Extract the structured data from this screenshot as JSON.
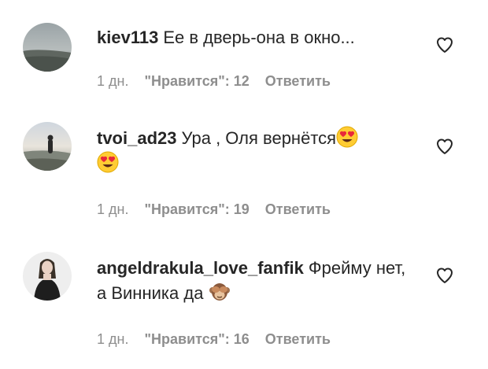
{
  "comments": [
    {
      "username": "kiev113",
      "text": "Ее в дверь-она в окно...",
      "time": "1 дн.",
      "likes": "\"Нравится\": 12",
      "reply": "Ответить",
      "avatar_icon": "avatar-photo-sea",
      "emojis": []
    },
    {
      "username": "tvoi_ad23",
      "text": "Ура , Оля вернётся",
      "time": "1 дн.",
      "likes": "\"Нравится\": 19",
      "reply": "Ответить",
      "avatar_icon": "avatar-photo-beach",
      "emojis": [
        "heart-eyes-emoji",
        "heart-eyes-emoji"
      ]
    },
    {
      "username": "angeldrakula_love_fanfik",
      "text": "Фрейму нет, а Винника да",
      "time": "1 дн.",
      "likes": "\"Нравится\": 16",
      "reply": "Ответить",
      "avatar_icon": "avatar-photo-girl",
      "emojis": [
        "see-no-evil-monkey-emoji"
      ]
    }
  ],
  "colors": {
    "text": "#262626",
    "meta": "#8e8e8e",
    "heart_outline": "#262626"
  }
}
